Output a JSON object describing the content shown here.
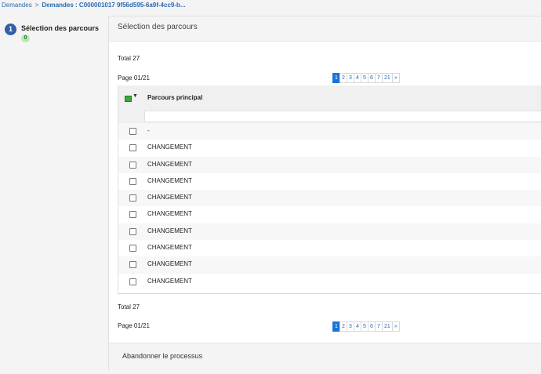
{
  "breadcrumb": {
    "root": "Demandes",
    "current": "Demandes : C000001017 9f56d595-6a9f-4cc9-b..."
  },
  "step": {
    "number": "1",
    "title": "Sélection des parcours",
    "badge": "0"
  },
  "panel": {
    "title": "Sélection des parcours",
    "total_label": "Total 27",
    "page_label": "Page 01/21",
    "pager": [
      "1",
      "2",
      "3",
      "4",
      "5",
      "6",
      "7",
      "21",
      "»"
    ],
    "active_page": "1"
  },
  "table": {
    "column_header": "Parcours principal",
    "filter_value": "",
    "rows": [
      "-",
      "CHANGEMENT",
      "CHANGEMENT",
      "CHANGEMENT",
      "CHANGEMENT",
      "CHANGEMENT",
      "CHANGEMENT",
      "CHANGEMENT",
      "CHANGEMENT",
      "CHANGEMENT"
    ]
  },
  "footer": {
    "total_label": "Total 27",
    "page_label": "Page 01/21",
    "abandon_label": "Abandonner le processus"
  },
  "colors": {
    "accent": "#1a73d9",
    "step_circle": "#2f5fa8",
    "badge_bg": "#b8e8b8",
    "link": "#2a6ab0"
  }
}
